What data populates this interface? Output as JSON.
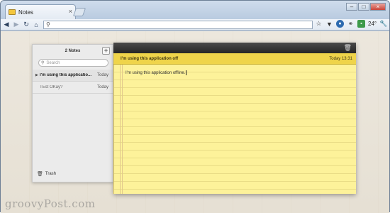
{
  "browser": {
    "tab_title": "Notes",
    "tab_close": "×",
    "window_controls": [
      "–",
      "□",
      "×"
    ],
    "temperature": "24°"
  },
  "notes_app": {
    "header_title": "2 Notes",
    "add_label": "+",
    "search_placeholder": "Search",
    "notes": [
      {
        "title": "I'm using this applicatio...",
        "date": "Today",
        "selected": true
      },
      {
        "title": "TEst OKay?",
        "date": "Today",
        "selected": false
      }
    ],
    "trash_label": "Trash"
  },
  "editor": {
    "title": "I'm using this application off",
    "date": "Today 13:31",
    "body": "I'm using this application offline."
  },
  "watermark": "groovyPost.com",
  "icons": {
    "back": "back-arrow-icon",
    "forward": "forward-arrow-icon",
    "reload": "reload-icon",
    "home": "home-icon",
    "search": "search-icon",
    "star": "star-icon",
    "trash": "trash-icon"
  },
  "colors": {
    "note_yellow": "#fdf29a",
    "note_title_bar": "#efd44a",
    "editor_top": "#262626"
  }
}
